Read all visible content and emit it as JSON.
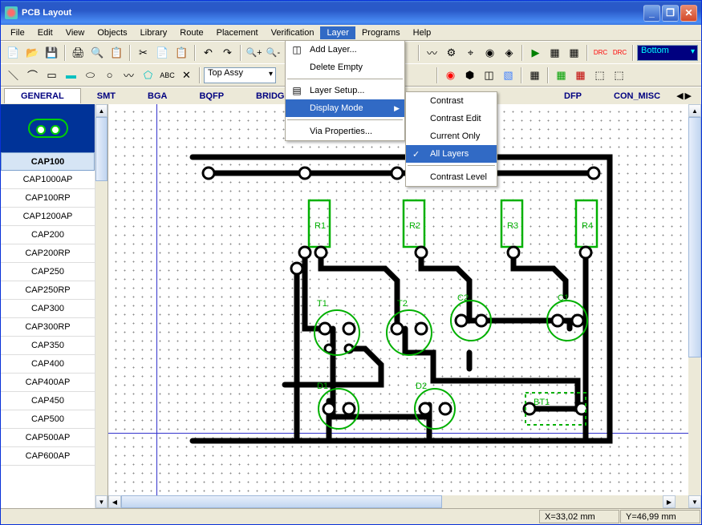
{
  "window": {
    "title": "PCB Layout"
  },
  "menubar": [
    "File",
    "Edit",
    "View",
    "Objects",
    "Library",
    "Route",
    "Placement",
    "Verification",
    "Layer",
    "Programs",
    "Help"
  ],
  "layer_dropdown": "Bottom",
  "assy_dropdown": "Top Assy",
  "layer_menu": {
    "add_layer": "Add Layer...",
    "delete_empty": "Delete Empty",
    "layer_setup": "Layer Setup...",
    "display_mode": "Display Mode",
    "via_properties": "Via Properties..."
  },
  "display_submenu": {
    "contrast": "Contrast",
    "contrast_edit": "Contrast Edit",
    "current_only": "Current Only",
    "all_layers": "All Layers",
    "contrast_level": "Contrast Level"
  },
  "categories": [
    "GENERAL",
    "SMT",
    "BGA",
    "BQFP",
    "BRIDG",
    "",
    "DFP",
    "CON_MISC"
  ],
  "components": [
    "CAP100",
    "CAP1000AP",
    "CAP100RP",
    "CAP1200AP",
    "CAP200",
    "CAP200RP",
    "CAP250",
    "CAP250RP",
    "CAP300",
    "CAP300RP",
    "CAP350",
    "CAP400",
    "CAP400AP",
    "CAP450",
    "CAP500",
    "CAP500AP",
    "CAP600AP"
  ],
  "selected_component": "CAP100",
  "pcb_labels": {
    "r1": "R1",
    "r2": "R2",
    "r3": "R3",
    "r4": "R4",
    "t1": "T1",
    "t2": "T2",
    "c1": "C1",
    "c2": "C2",
    "d1": "D1",
    "d2": "D2",
    "bt1": "BT1"
  },
  "status": {
    "x": "X=33,02 mm",
    "y": "Y=46,99 mm"
  }
}
